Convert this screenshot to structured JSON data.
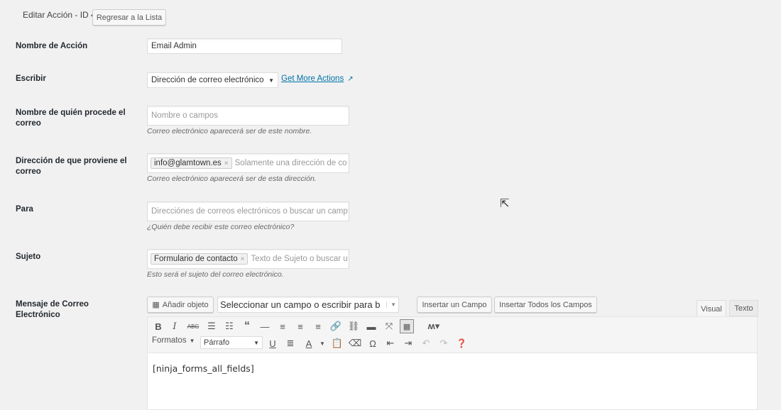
{
  "header": {
    "title": "Editar Acción - ID 4",
    "back_button": "Regresar a la Lista"
  },
  "fields": {
    "action_name": {
      "label": "Nombre de Acción",
      "value": "Email Admin"
    },
    "type": {
      "label": "Escribir",
      "value": "Dirección de correo electrónico",
      "more_link": "Get More Actions"
    },
    "from_name": {
      "label": "Nombre de quién procede el correo",
      "placeholder": "Nombre o campos",
      "desc": "Correo electrónico aparecerá ser de este nombre."
    },
    "from_address": {
      "label": "Dirección de que proviene el correo",
      "tag": "info@glamtown.es",
      "placeholder": "Solamente una dirección de co",
      "desc": "Correo electrónico aparecerá ser de esta dirección."
    },
    "to": {
      "label": "Para",
      "placeholder": "Direcciónes de correos electrónicos o buscar un camp",
      "desc": "¿Quién debe recibir este correo electrónico?"
    },
    "subject": {
      "label": "Sujeto",
      "tag": "Formulario de contacto",
      "placeholder": "Texto de Sujeto o buscar u",
      "desc": "Esto será el sujeto del correo electrónico."
    },
    "message": {
      "label": "Mensaje de Correo Electrónico"
    }
  },
  "editor": {
    "add_media": "Añadir objeto",
    "field_select": "Seleccionar un campo o escribir para b",
    "insert_field": "Insertar un Campo",
    "insert_all": "Insertar Todos los Campos",
    "tab_visual": "Visual",
    "tab_text": "Texto",
    "formats": "Formatos",
    "paragraph": "Párrafo",
    "content": "[ninja_forms_all_fields]"
  }
}
